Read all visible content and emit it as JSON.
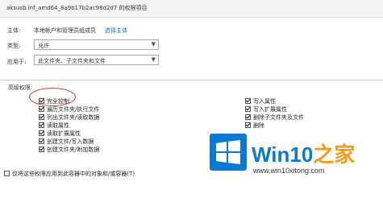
{
  "window": {
    "title": "aksusb.inf_amd64_8a9b17b2ac98d2d7 的权限项目"
  },
  "principal": {
    "label": "主体:",
    "value": "本地帐户和管理员组成员",
    "select_link": "选择主体"
  },
  "type_field": {
    "label": "类型:",
    "value": "允许"
  },
  "applies_to": {
    "label": "应用于:",
    "value": "此文件夹、子文件夹和文件"
  },
  "advanced": {
    "label": "高级权限:",
    "left_perms": [
      {
        "label": "完全控制",
        "checked": true
      },
      {
        "label": "遍历文件夹/执行文件",
        "checked": true
      },
      {
        "label": "列出文件夹/读取数据",
        "checked": true
      },
      {
        "label": "读取属性",
        "checked": true
      },
      {
        "label": "读取扩展属性",
        "checked": true
      },
      {
        "label": "创建文件/写入数据",
        "checked": true
      },
      {
        "label": "创建文件夹/附加数据",
        "checked": true
      }
    ],
    "right_perms": [
      {
        "label": "写入属性",
        "checked": true
      },
      {
        "label": "写入扩展属性",
        "checked": true
      },
      {
        "label": "删除子文件夹及文件",
        "checked": true
      },
      {
        "label": "删除",
        "checked": true
      }
    ]
  },
  "apply_option": {
    "label": "仅将这些权限应用到此容器中的对象和/或容器(T)",
    "checked": false
  },
  "watermark": {
    "brand_main": "Win10",
    "brand_accent": "之家",
    "url": "www.win10xitong.com",
    "color": "#0a79d4",
    "accent_color": "#f29b1a"
  },
  "colors": {
    "link": "#1a6fc7",
    "annotation_circle": "#e0303a"
  }
}
